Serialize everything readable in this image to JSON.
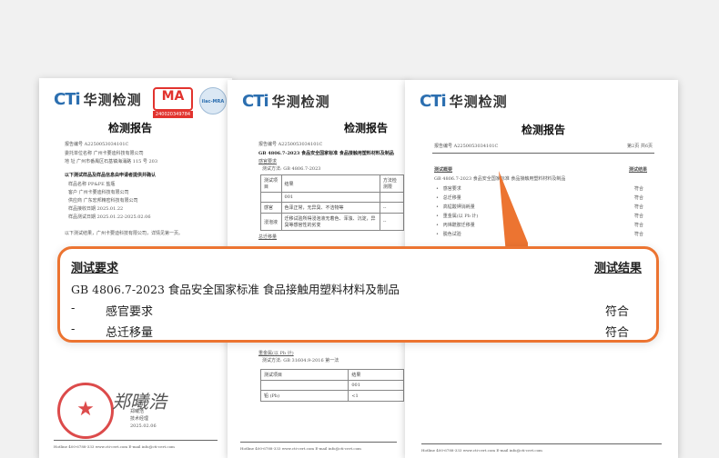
{
  "logo": {
    "latin": "CTi",
    "chinese": "华测检测"
  },
  "report_title": "检测报告",
  "report1": {
    "cma_text": "MA",
    "cma_number": "240020349784",
    "ilac_text": "ilac-MRA",
    "meta_lines": [
      "报告编号    A2250053034101C",
      "委托单位名称    广州卡要迪科技有限公司",
      "地      址    广州市番禺区石基镇海涌路 115 号 203"
    ],
    "section": "以下测试样品及样品信息由申请者提供并确认",
    "info_lines": [
      "样品名称          PP&PE 盐瓶",
      "客户              广州卡要迪科技有限公司",
      "供应商            广东宏邦精密科技有限公司",
      "样品接收日期      2025.01.22",
      "样品测试日期      2025.01.22-2025.02.06"
    ],
    "note": "以下测试结果，广州卡要迪科技有限公司，详情见第一页。",
    "signer_name": "郑曦浩",
    "signer_title": "技术经理",
    "sign_date": "2025.02.06",
    "signature": "郑曦浩",
    "footer": "Hotline 400-6788-333  www.cti-cert.com  E-mail  info@cti-cert.com"
  },
  "report2": {
    "meta_lines": [
      "报告编号    A2250053034101C"
    ],
    "standard_line": "GB 4806.7-2023  食品安全国家标准  食品接触用塑料材料及制品",
    "sensory_heading": "感官要求",
    "method_line": "测试方法: GB 4806.7-2023",
    "table_rows": [
      [
        "测试项目",
        "结果",
        "方法检测限"
      ],
      [
        "",
        "001",
        ""
      ],
      [
        "感官",
        "色泽正常，无异臭、不洁物等",
        "--"
      ],
      [
        "浸泡液",
        "迁移试验所得浸泡液无着色、浑浊、沉淀，异臭等感官性的劣变",
        "--"
      ]
    ],
    "migration_heading": "总迁移量",
    "heavy_heading": "重金属(以 Pb 计)",
    "heavy_method": "测试方法: GB 31604.9-2016 第一法",
    "heavy_rows": [
      [
        "测试项目",
        "结果"
      ],
      [
        "",
        "001"
      ],
      [
        "铅 (Pb)",
        "<1"
      ]
    ],
    "footer": "Hotline 400-6788-333  www.cti-cert.com  E-mail  info@cti-cert.com"
  },
  "report3": {
    "meta_line": "报告编号    A2250053034101C",
    "page_info": "第2页 共6页",
    "summary_heading": "测试概要",
    "result_heading": "测试结果",
    "standard_line": "GB 4806.7-2023 食品安全国家标准 食品接触用塑料材料及制品",
    "items": [
      {
        "label": "感官要求",
        "result": "符合"
      },
      {
        "label": "总迁移量",
        "result": "符合"
      },
      {
        "label": "高锰酸钾消耗量",
        "result": "符合"
      },
      {
        "label": "重金属(以 Pb 计)",
        "result": "符合"
      },
      {
        "label": "丙烯酰胺迁移量",
        "result": "符合"
      },
      {
        "label": "脱色试验",
        "result": "符合"
      }
    ],
    "footer": "Hotline 400-6788-333  www.cti-cert.com  E-mail  info@cti-cert.com"
  },
  "callout": {
    "left_header": "测试要求",
    "right_header": "测试结果",
    "standard": "GB 4806.7-2023  食品安全国家标准  食品接触用塑料材料及制品",
    "rows": [
      {
        "bullet": "-",
        "label": "感官要求",
        "result": "符合"
      },
      {
        "bullet": "-",
        "label": "总迁移量",
        "result": "符合"
      }
    ]
  },
  "colors": {
    "accent": "#ec7431",
    "brand_blue": "#2c6fb0",
    "seal_red": "#d72c2c"
  }
}
